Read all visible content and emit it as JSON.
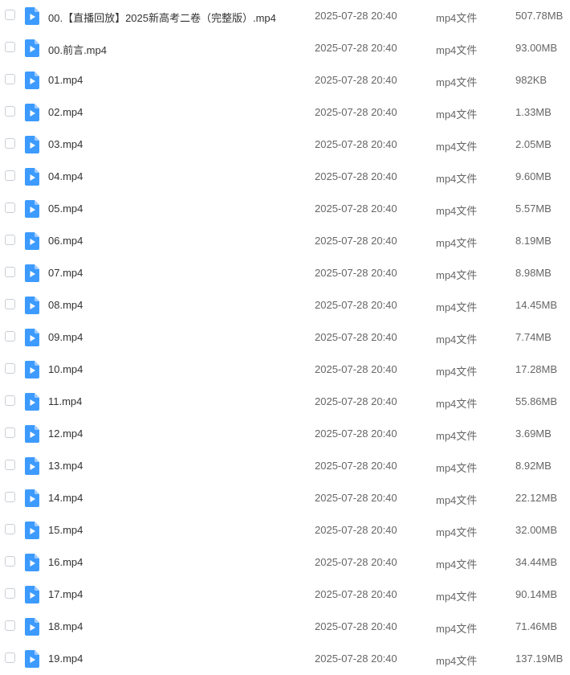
{
  "icons": {
    "file_icon": "video-file-icon",
    "checkbox": "checkbox"
  },
  "colors": {
    "icon_blue": "#3d9bff",
    "icon_fold": "#9fcbff"
  },
  "files": [
    {
      "name": "00.【直播回放】2025新高考二卷（完整版）.mp4",
      "date": "2025-07-28 20:40",
      "type": "mp4文件",
      "size": "507.78MB"
    },
    {
      "name": "00.前言.mp4",
      "date": "2025-07-28 20:40",
      "type": "mp4文件",
      "size": "93.00MB"
    },
    {
      "name": "01.mp4",
      "date": "2025-07-28 20:40",
      "type": "mp4文件",
      "size": "982KB"
    },
    {
      "name": "02.mp4",
      "date": "2025-07-28 20:40",
      "type": "mp4文件",
      "size": "1.33MB"
    },
    {
      "name": "03.mp4",
      "date": "2025-07-28 20:40",
      "type": "mp4文件",
      "size": "2.05MB"
    },
    {
      "name": "04.mp4",
      "date": "2025-07-28 20:40",
      "type": "mp4文件",
      "size": "9.60MB"
    },
    {
      "name": "05.mp4",
      "date": "2025-07-28 20:40",
      "type": "mp4文件",
      "size": "5.57MB"
    },
    {
      "name": "06.mp4",
      "date": "2025-07-28 20:40",
      "type": "mp4文件",
      "size": "8.19MB"
    },
    {
      "name": "07.mp4",
      "date": "2025-07-28 20:40",
      "type": "mp4文件",
      "size": "8.98MB"
    },
    {
      "name": "08.mp4",
      "date": "2025-07-28 20:40",
      "type": "mp4文件",
      "size": "14.45MB"
    },
    {
      "name": "09.mp4",
      "date": "2025-07-28 20:40",
      "type": "mp4文件",
      "size": "7.74MB"
    },
    {
      "name": "10.mp4",
      "date": "2025-07-28 20:40",
      "type": "mp4文件",
      "size": "17.28MB"
    },
    {
      "name": "11.mp4",
      "date": "2025-07-28 20:40",
      "type": "mp4文件",
      "size": "55.86MB"
    },
    {
      "name": "12.mp4",
      "date": "2025-07-28 20:40",
      "type": "mp4文件",
      "size": "3.69MB"
    },
    {
      "name": "13.mp4",
      "date": "2025-07-28 20:40",
      "type": "mp4文件",
      "size": "8.92MB"
    },
    {
      "name": "14.mp4",
      "date": "2025-07-28 20:40",
      "type": "mp4文件",
      "size": "22.12MB"
    },
    {
      "name": "15.mp4",
      "date": "2025-07-28 20:40",
      "type": "mp4文件",
      "size": "32.00MB"
    },
    {
      "name": "16.mp4",
      "date": "2025-07-28 20:40",
      "type": "mp4文件",
      "size": "34.44MB"
    },
    {
      "name": "17.mp4",
      "date": "2025-07-28 20:40",
      "type": "mp4文件",
      "size": "90.14MB"
    },
    {
      "name": "18.mp4",
      "date": "2025-07-28 20:40",
      "type": "mp4文件",
      "size": "71.46MB"
    },
    {
      "name": "19.mp4",
      "date": "2025-07-28 20:40",
      "type": "mp4文件",
      "size": "137.19MB"
    }
  ]
}
